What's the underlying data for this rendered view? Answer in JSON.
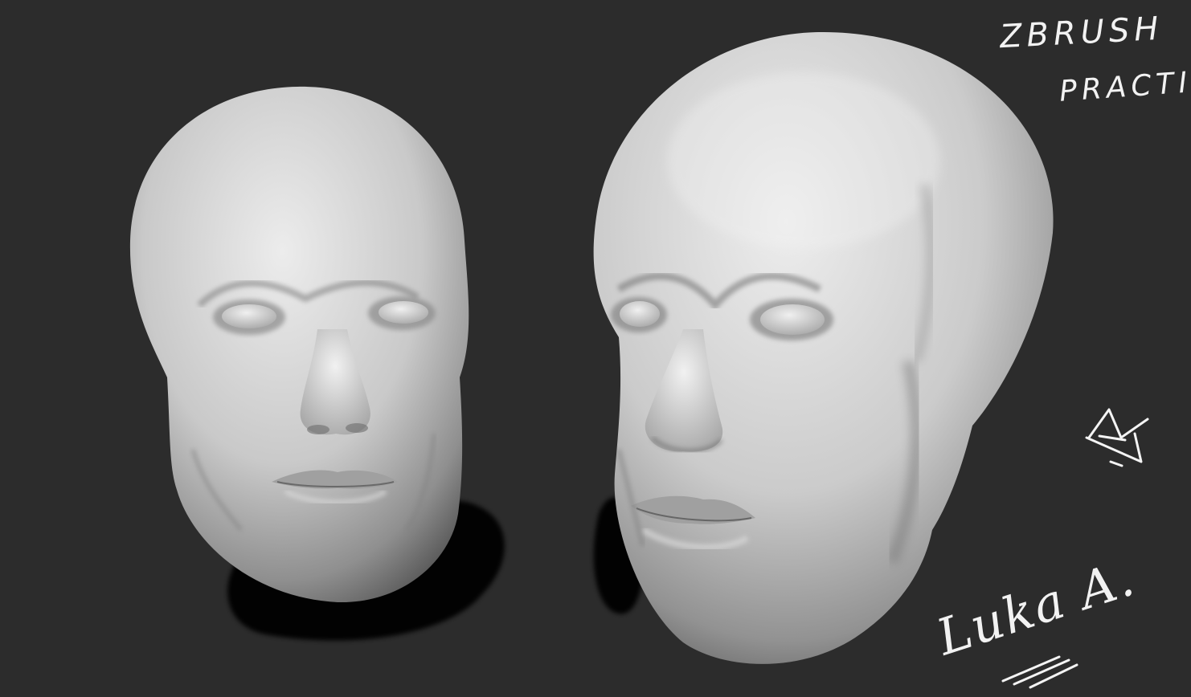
{
  "canvas": {
    "background": "#2c2c2c"
  },
  "annotations": {
    "title_line1": "ZBRUSH",
    "title_line2": "PRACTICE",
    "signature": "Luka A."
  },
  "sculpts": [
    {
      "label": "front-view-head"
    },
    {
      "label": "three-quarter-view-head"
    }
  ],
  "colors": {
    "clay_light": "#e6e6e6",
    "clay_mid": "#bdbdbd",
    "clay_dark": "#6f6f6f",
    "shadow": "#000000",
    "ink": "#f4f4f4"
  }
}
